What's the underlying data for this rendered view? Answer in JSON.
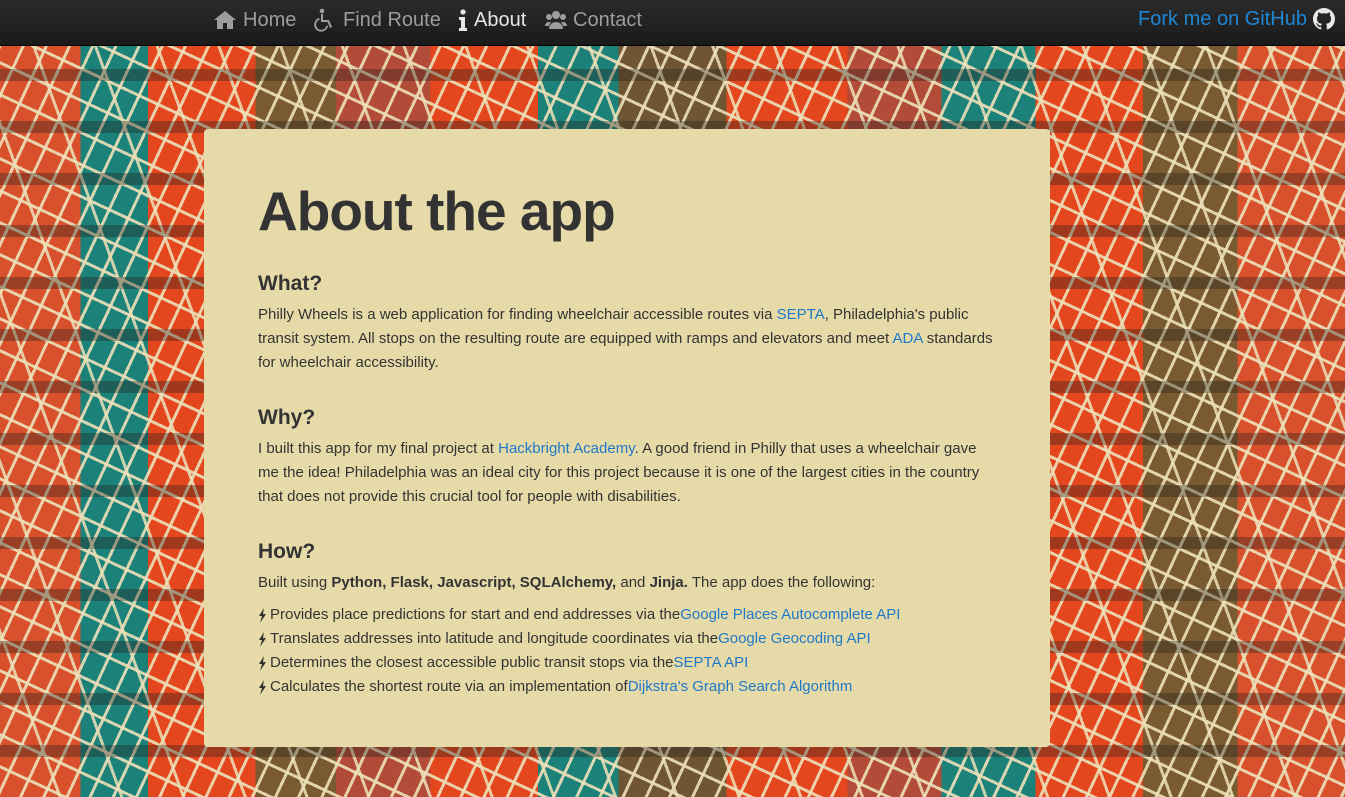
{
  "nav": {
    "home": "Home",
    "find_route": "Find Route",
    "about": "About",
    "contact": "Contact",
    "fork": "Fork me on GitHub"
  },
  "page": {
    "title": "About the app",
    "what": {
      "heading": "What?",
      "p1": "Philly Wheels is a web application for finding wheelchair accessible routes via ",
      "septa": "SEPTA",
      "p2": ", Philadelphia's public transit system. All stops on the resulting route are equipped with ramps and elevators and meet ",
      "ada": "ADA",
      "p3": " standards for wheelchair accessibility."
    },
    "why": {
      "heading": "Why?",
      "p1": "I built this app for my final project at ",
      "hackbright": "Hackbright Academy",
      "p2": ". A good friend in Philly that uses a wheelchair gave me the idea! Philadelphia was an ideal city for this project because it is one of the largest cities in the country that does not provide this crucial tool for people with disabilities."
    },
    "how": {
      "heading": "How?",
      "intro_pre": "Built using ",
      "tech": "Python, Flask, Javascript, SQLAlchemy,",
      "and": " and ",
      "jinja": "Jinja.",
      "intro_post": " The app does the following:",
      "items": [
        {
          "text": " Provides place predictions for start and end addresses via the ",
          "link": "Google Places Autocomplete API"
        },
        {
          "text": "Translates addresses into latitude and longitude coordinates via the ",
          "link": "Google Geocoding API"
        },
        {
          "text": "Determines the closest accessible public transit stops via the ",
          "link": "SEPTA API"
        },
        {
          "text": "Calculates the shortest route via an implementation of ",
          "link": "Dijkstra's Graph Search Algorithm"
        }
      ]
    }
  }
}
